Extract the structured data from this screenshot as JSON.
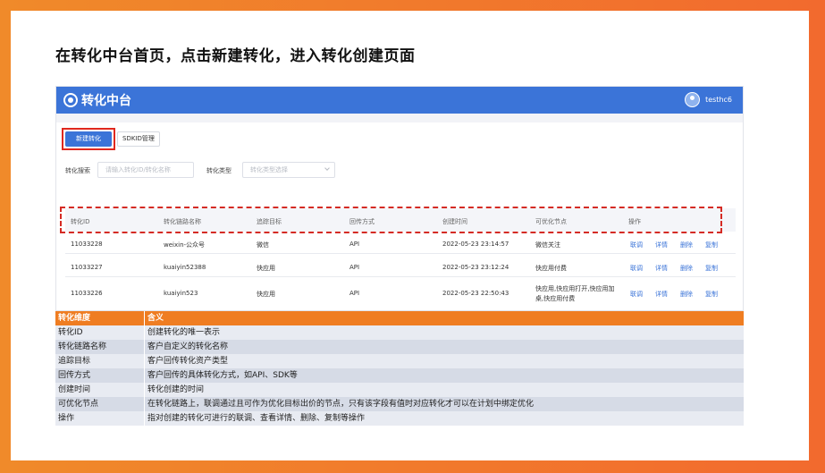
{
  "slide": {
    "title": "在转化中台首页，点击新建转化，进入转化创建页面"
  },
  "app": {
    "name": "转化中台",
    "user": "testhc6",
    "toolbar": {
      "new_button": "新建转化",
      "sdk_button": "SDKID管理"
    },
    "filters": {
      "search_label": "转化搜索",
      "search_placeholder": "请输入转化ID/转化名称",
      "type_label": "转化类型",
      "type_placeholder": "转化类型选择"
    },
    "table": {
      "headers": [
        "转化ID",
        "转化链路名称",
        "追踪目标",
        "回传方式",
        "创建时间",
        "可优化节点",
        "操作"
      ],
      "rows": [
        {
          "id": "11033228",
          "name": "weixin-公众号",
          "target": "微信",
          "method": "API",
          "created": "2022-05-23 23:14:57",
          "node": "微信关注"
        },
        {
          "id": "11033227",
          "name": "kuaiyin52388",
          "target": "快应用",
          "method": "API",
          "created": "2022-05-23 23:12:24",
          "node": "快应用付费"
        },
        {
          "id": "11033226",
          "name": "kuaiyin523",
          "target": "快应用",
          "method": "API",
          "created": "2022-05-23 22:50:43",
          "node_line1": "快应用,快应用打开,快应用加",
          "node_line2": "桌,快应用付费"
        }
      ],
      "actions": [
        "联调",
        "详情",
        "删除",
        "复制"
      ]
    }
  },
  "definitions": {
    "header": [
      "转化维度",
      "含义"
    ],
    "rows": [
      [
        "转化ID",
        "创建转化的唯一表示"
      ],
      [
        "转化链路名称",
        "客户自定义的转化名称"
      ],
      [
        "追踪目标",
        "客户回传转化资产类型"
      ],
      [
        "回传方式",
        "客户回传的具体转化方式，如API、SDK等"
      ],
      [
        "创建时间",
        "转化创建的时间"
      ],
      [
        "可优化节点",
        "在转化链路上，联调通过且可作为优化目标出价的节点，只有该字段有值时对应转化才可以在计划中绑定优化"
      ],
      [
        "操作",
        "指对创建的转化可进行的联调、查看详情、删除、复制等操作"
      ]
    ]
  },
  "colors": {
    "accent": "#ef7d22",
    "brand": "#3b74d8",
    "highlight": "#d52b24"
  }
}
